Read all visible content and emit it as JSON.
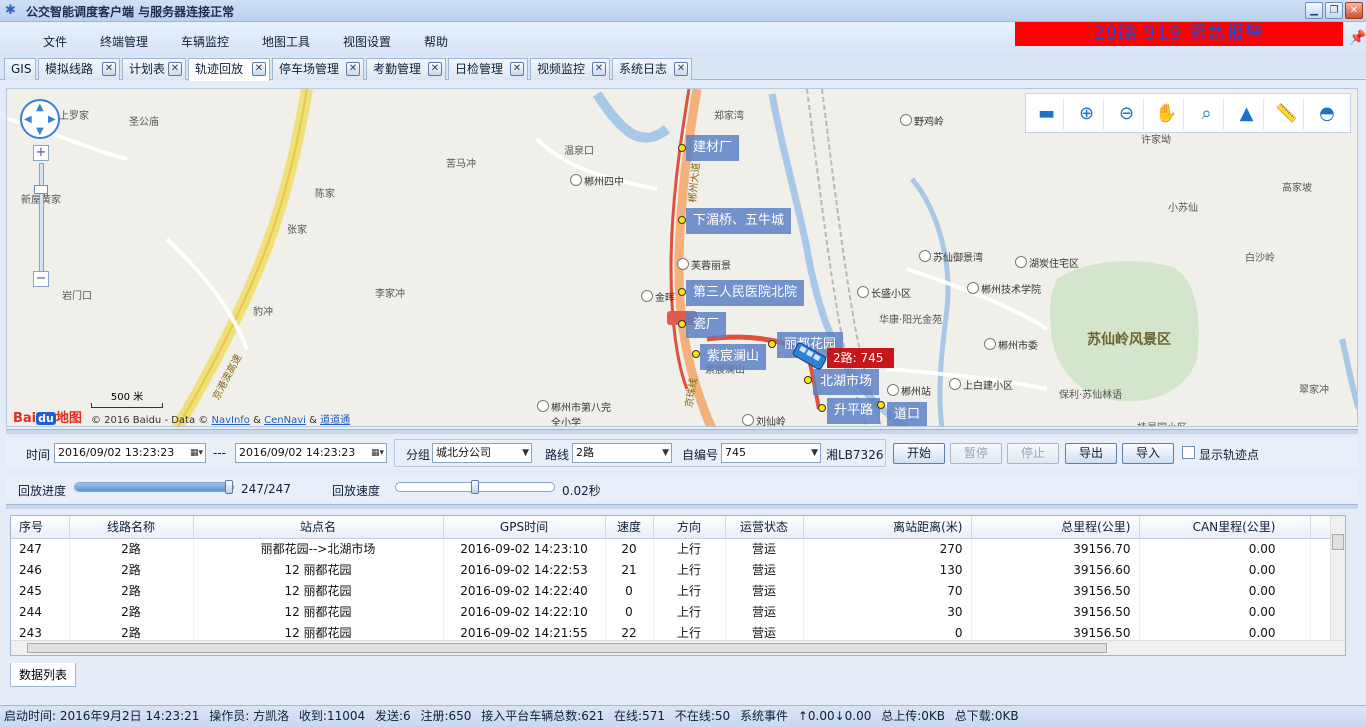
{
  "window": {
    "title": "公交智能调度客户端 与服务器连接正常"
  },
  "menu": [
    "文件",
    "终端管理",
    "车辆监控",
    "地图工具",
    "视图设置",
    "帮助"
  ],
  "alarm": "29路 919 紧急报警",
  "tabs": [
    "GIS",
    "模拟线路",
    "计划表",
    "轨迹回放",
    "停车场管理",
    "考勤管理",
    "日检管理",
    "视频监控",
    "系统日志"
  ],
  "active_tab": "轨迹回放",
  "map": {
    "labels": [
      "郑家湾",
      "温泉口",
      "苦马冲",
      "郴州四中",
      "芙蓉丽景",
      "金晖",
      "野鸡岭",
      "许家坳",
      "高家坡",
      "小苏仙",
      "湖炭住宅区",
      "白沙岭",
      "苏仙御景湾",
      "郴州技术学院",
      "长盛小区",
      "华康·阳光金苑",
      "郴州市委",
      "上白建小区",
      "保利·苏仙林语",
      "翠家冲",
      "刘仙岭",
      "郴州市第八完全小学",
      "紫宸澜山",
      "郴州站",
      "桂景园小区",
      "圣公庙",
      "陈家",
      "张家",
      "岩门口",
      "李家冲",
      "豹冲",
      "新屋黄家",
      "上罗家",
      "京港澳高速",
      "京珠线",
      "郴州大道"
    ],
    "big_label": "苏仙岭风景区",
    "stops": [
      "建材厂",
      "下湄桥、五牛城",
      "第三人民医院北院",
      "瓷厂",
      "紫宸澜山",
      "丽都花园",
      "北湖市场",
      "升平路",
      "道口"
    ],
    "bus_label": "2路: 745",
    "scale": "500 米",
    "logo": "Bai地图",
    "copyright": {
      "prefix": "© 2016 Baidu - Data ©",
      "navinfo": "NavInfo",
      "and1": "&",
      "cennavi": "CenNavi",
      "and2": "&",
      "daodao": "道道通"
    },
    "tools": [
      "label-icon",
      "zoom-in-icon",
      "zoom-out-icon",
      "pan-hand-icon",
      "zoom-area-icon",
      "cone-icon",
      "ruler-icon",
      "protractor-icon"
    ]
  },
  "filter": {
    "time_label": "时间",
    "start": "2016/09/02 13:23:23",
    "dash": "---",
    "end": "2016/09/02 14:23:23",
    "group_label": "分组",
    "group": "城北分公司",
    "route_label": "路线",
    "route": "2路",
    "self_label": "自编号",
    "self": "745",
    "plate": "湘LB7326",
    "buttons": {
      "start": "开始",
      "pause": "暂停",
      "stop": "停止",
      "export": "导出",
      "import": "导入"
    },
    "show_points": "显示轨迹点"
  },
  "playback": {
    "progress_label": "回放进度",
    "progress": "247/247",
    "progress_fraction": 1.0,
    "speed_label": "回放速度",
    "speed": "0.02秒",
    "speed_fraction": 0.5
  },
  "table": {
    "columns": [
      "序号",
      "线路名称",
      "站点名",
      "GPS时间",
      "速度",
      "方向",
      "运营状态",
      "离站距离(米)",
      "总里程(公里)",
      "CAN里程(公里)"
    ],
    "rows": [
      [
        "247",
        "2路",
        "丽都花园-->北湖市场",
        "2016-09-02 14:23:10",
        "20",
        "上行",
        "营运",
        "270",
        "39156.70",
        "0.00"
      ],
      [
        "246",
        "2路",
        "12 丽都花园",
        "2016-09-02 14:22:53",
        "21",
        "上行",
        "营运",
        "130",
        "39156.60",
        "0.00"
      ],
      [
        "245",
        "2路",
        "12 丽都花园",
        "2016-09-02 14:22:40",
        "0",
        "上行",
        "营运",
        "70",
        "39156.50",
        "0.00"
      ],
      [
        "244",
        "2路",
        "12 丽都花园",
        "2016-09-02 14:22:10",
        "0",
        "上行",
        "营运",
        "30",
        "39156.50",
        "0.00"
      ],
      [
        "243",
        "2路",
        "12 丽都花园",
        "2016-09-02 14:21:55",
        "22",
        "上行",
        "营运",
        "0",
        "39156.50",
        "0.00"
      ]
    ]
  },
  "bottom_tab": "数据列表",
  "status": [
    "启动时间: 2016年9月2日 14:23:21",
    "操作员: 方凯洛",
    "收到:11004",
    "发送:6",
    "注册:650",
    "接入平台车辆总数:621",
    "在线:571",
    "不在线:50",
    "系统事件",
    "↑0.00↓0.00",
    "总上传:0KB",
    "总下载:0KB"
  ]
}
